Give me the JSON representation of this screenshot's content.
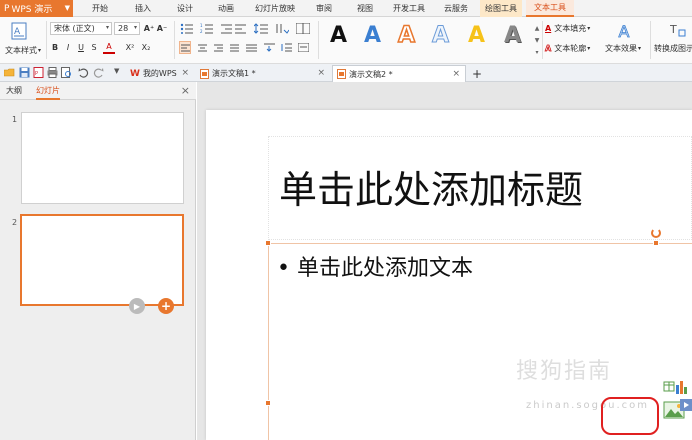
{
  "app": {
    "name": "WPS 演示"
  },
  "menu_tabs": [
    "开始",
    "插入",
    "设计",
    "动画",
    "幻灯片放映",
    "审阅",
    "视图",
    "开发工具",
    "云服务",
    "绘图工具",
    "文本工具"
  ],
  "ribbon": {
    "text_style_label": "文本样式",
    "font_name": "宋体 (正文)",
    "font_size": "28",
    "text_fill_label": "文本填充",
    "text_outline_label": "文本轮廓",
    "text_effect_label": "文本效果",
    "convert_label": "转换成图示",
    "buttons": {
      "bold": "B",
      "italic": "I",
      "underline": "U",
      "strike": "S",
      "font_color": "A",
      "superscript": "X²",
      "subscript": "X₂",
      "grow": "A⁺",
      "shrink": "A⁻"
    }
  },
  "doc_tabs": [
    {
      "label": "我的WPS"
    },
    {
      "label": "演示文稿1 *"
    },
    {
      "label": "演示文稿2 *"
    }
  ],
  "new_tab": "+",
  "left_pane": {
    "tabs": [
      "大纲",
      "幻灯片"
    ],
    "close": "×",
    "slides": [
      {
        "number": "1"
      },
      {
        "number": "2"
      }
    ]
  },
  "slide": {
    "title_placeholder": "单击此处添加标题",
    "body_placeholder": "• 单击此处添加文本"
  },
  "watermark": {
    "main": "搜狗指南",
    "sub": "zhinan.sogou.com"
  },
  "colors": {
    "accent": "#e8772e",
    "highlight_circle": "#e02020"
  }
}
